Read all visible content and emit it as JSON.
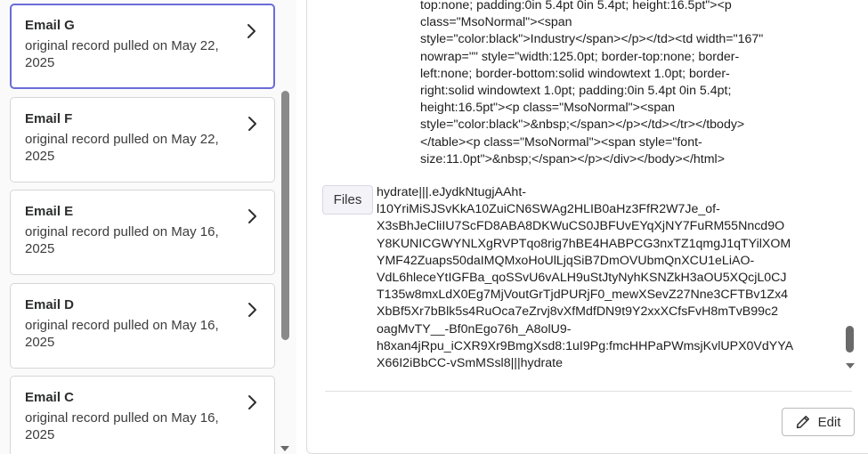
{
  "emails": [
    {
      "title": "Email G",
      "subtitle": "original record pulled on May 22, 2025",
      "selected": true
    },
    {
      "title": "Email F",
      "subtitle": "original record pulled on May 22, 2025",
      "selected": false
    },
    {
      "title": "Email E",
      "subtitle": "original record pulled on May 16, 2025",
      "selected": false
    },
    {
      "title": "Email D",
      "subtitle": "original record pulled on May 16, 2025",
      "selected": false
    },
    {
      "title": "Email C",
      "subtitle": "original record pulled on May 16, 2025",
      "selected": false
    }
  ],
  "detail": {
    "html_lines": [
      "top:none; padding:0in 5.4pt 0in 5.4pt; height:16.5pt\"><p",
      "class=\"MsoNormal\"><span",
      "style=\"color:black\">Industry</span></p></td><td width=\"167\"",
      "nowrap=\"\" style=\"width:125.0pt; border-top:none; border-",
      "left:none; border-bottom:solid windowtext 1.0pt; border-",
      "right:solid windowtext 1.0pt; padding:0in 5.4pt 0in 5.4pt;",
      "height:16.5pt\"><p class=\"MsoNormal\"><span",
      "style=\"color:black\">&nbsp;</span></p></td></tr></tbody>",
      "</table><p class=\"MsoNormal\"><span style=\"font-",
      "size:11.0pt\">&nbsp;</span></p></div></body></html>"
    ],
    "files_label": "Files",
    "files_lines": [
      "hydrate|||.eJydkNtugjAAht-",
      "l10YriMiSJSvKkA10ZuiCN6SWAg2HLIB0aHz3FfR2W7Je_of-",
      "X3sBhJeCliIU7ScFD8ABA8DKWuCS0JBFUvEYqXjNY7FuRM55Nncd9O",
      "Y8KUNICGWYNLXgRVPTqo8rig7hBE4HABPCG3nxTZ1qmgJ1qTYilXOM",
      "YMF42Zuaps50daIMQMxoHoUlLjqSiB7DmOVUbmQnXCU1eLiAO-",
      "VdL6hleceYtIGFBa_qoSSvU6vALH9uStJtyNyhKSNZkH3aOU5XQcjL0CJ",
      "T135w8mxLdX0Eg7MjVoutGrTjdPURjF0_mewXSevZ27Nne3CFTBv1Zx4",
      "XbBf5Xr7bBlk5s4RuOca7eZrvj8vXfMdfDN9t9Y2xxXCfsFvH8mTvB99c2",
      "oagMvTY__-Bf0nEgo76h_A8olU9-",
      "h8xan4jRpu_iCXR9Xr9BmgXsd8:1uI9Pg:fmcHHPaPWmsjKvlUPX0VdYYA",
      "X66I2iBbCC-vSmMSsl8|||hydrate"
    ],
    "edit_label": "Edit"
  },
  "icons": {
    "chevron": "chevron-right-icon",
    "edit": "pencil-icon",
    "scroll_down": "scroll-down-arrow-icon"
  },
  "colors": {
    "selected_border": "#6b6bd9",
    "card_border": "#d6d6d6",
    "files_badge_bg": "#f3f3f8"
  }
}
